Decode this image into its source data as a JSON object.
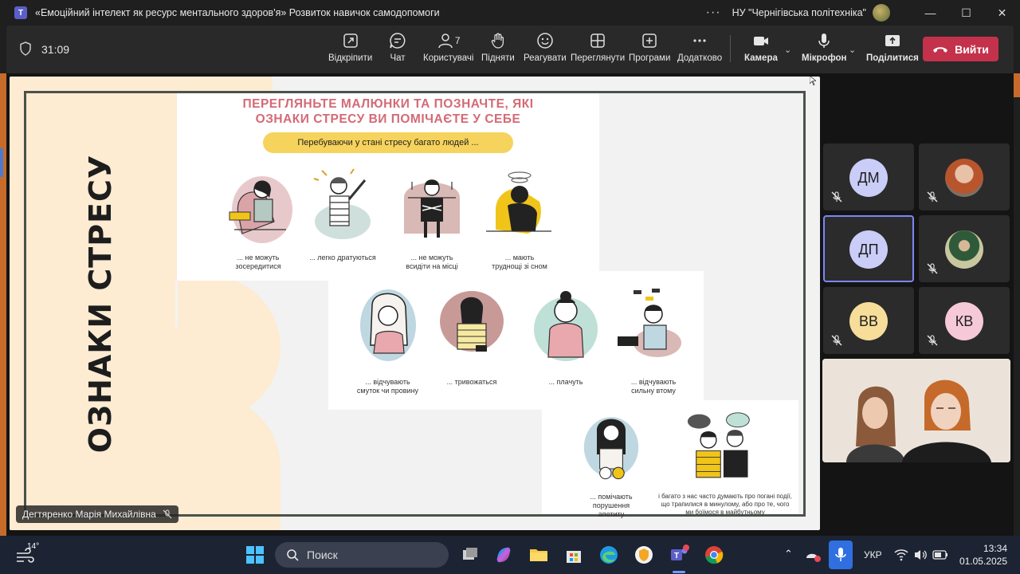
{
  "window": {
    "title": "«Емоційний інтелект як ресурс ментального здоров'я» Розвиток навичок самодопомоги",
    "more": "···",
    "org": "НУ \"Чернігівська політехніка\"",
    "logo_letter": "T"
  },
  "toolbar": {
    "timer": "31:09",
    "buttons": {
      "popout": "Відкріпити",
      "chat": "Чат",
      "people": "Користувачі",
      "people_count": "7",
      "raise": "Підняти",
      "react": "Реагувати",
      "view": "Переглянути",
      "apps": "Програми",
      "more": "Додатково",
      "camera": "Камера",
      "mic": "Мікрофон",
      "share": "Поділитися"
    },
    "leave_label": "Вийти"
  },
  "slide": {
    "vertical_title": "ОЗНАКИ СТРЕСУ",
    "heading_line1": "ПЕРЕГЛЯНЬТЕ МАЛЮНКИ ТА ПОЗНАЧТЕ, ЯКІ",
    "heading_line2": "ОЗНАКИ СТРЕСУ ВИ ПОМІЧАЄТЕ У СЕБЕ",
    "pill": "Перебуваючи у стані стресу багато людей ...",
    "captions": [
      "... не можуть\nзосередитися",
      "... легко дратуються",
      "... не можуть\nвсидіти на місці",
      "... мають\nтруднощі зі сном",
      "... відчувають\nсмуток чи провину",
      "... тривожаться",
      "... плачуть",
      "... відчувають\nсильну втому",
      "... помічають\nпорушення\nапетиту",
      "і багато з нас часто думають про погані події,\nщо трапилися в минулому, або про те, чого\nми боїмося в майбутньому"
    ]
  },
  "presenter": {
    "name": "Дегтяренко Марія Михайлівна"
  },
  "participants": [
    {
      "initials": "ДМ",
      "color": "#c9cdf7"
    },
    {
      "initials": "",
      "color": "#b8552c"
    },
    {
      "initials": "ДП",
      "color": "#c9cdf7"
    },
    {
      "initials": "",
      "color": "#6b8a3a"
    },
    {
      "initials": "ВВ",
      "color": "#f6dd9a"
    },
    {
      "initials": "КВ",
      "color": "#f6c9d8"
    }
  ],
  "taskbar": {
    "temp": "14°",
    "search_placeholder": "Поиск",
    "lang": "УКР",
    "time": "13:34",
    "date": "01.05.2025"
  }
}
